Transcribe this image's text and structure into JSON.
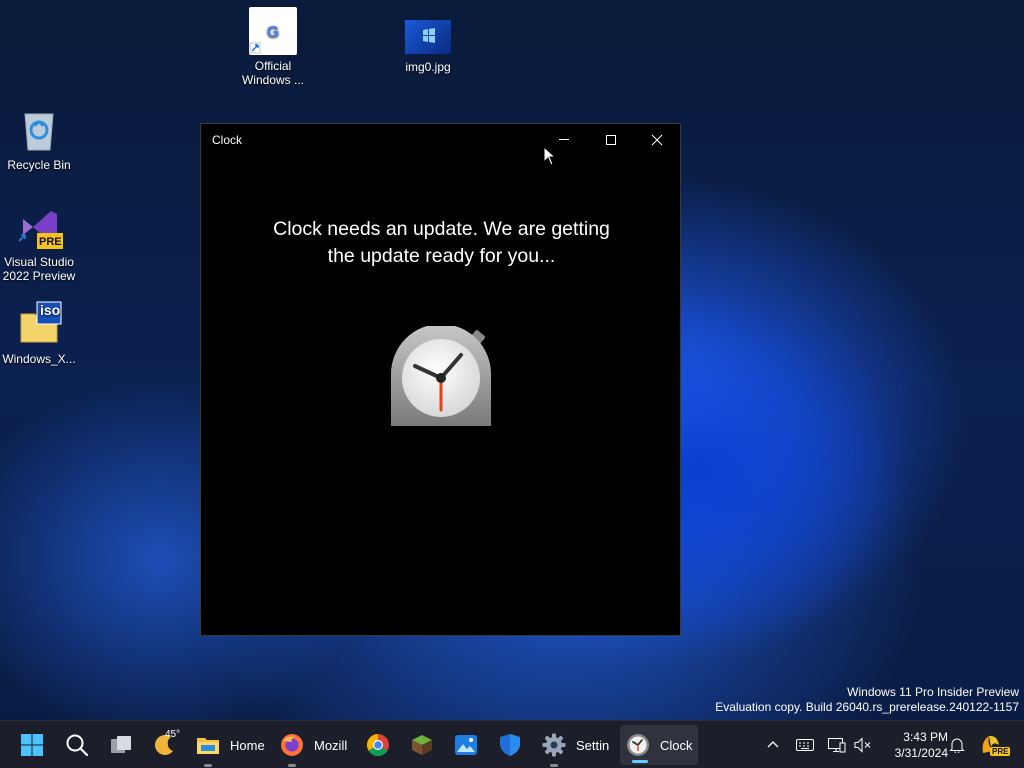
{
  "desktop": {
    "icons": [
      {
        "label": "Official Windows ...",
        "label_l1": "Official",
        "label_l2": "Windows ..."
      },
      {
        "label": "img0.jpg"
      },
      {
        "label": "Recycle Bin"
      },
      {
        "label": "Visual Studio 2022 Preview",
        "label_l1": "Visual Studio",
        "label_l2": "2022 Preview",
        "badge": "PRE"
      },
      {
        "label": "Windows_X...",
        "badge": "iso"
      }
    ]
  },
  "window": {
    "title": "Clock",
    "message_line1": "Clock needs an update. We are getting",
    "message_line2": "the update ready for you...",
    "controls": {
      "minimize": "minimize-icon",
      "maximize": "maximize-icon",
      "close": "close-icon"
    }
  },
  "watermark": {
    "line1": "Windows 11 Pro Insider Preview",
    "line2": "Evaluation copy. Build 26040.rs_prerelease.240122-1157"
  },
  "taskbar": {
    "weather_temp": "45°",
    "items": [
      {
        "name": "start",
        "icon": "windows-logo-icon"
      },
      {
        "name": "search",
        "icon": "search-icon"
      },
      {
        "name": "task-view",
        "icon": "task-view-icon"
      },
      {
        "name": "weather",
        "icon": "weather-icon"
      },
      {
        "name": "file-explorer",
        "label": "Home",
        "icon": "folder-icon"
      },
      {
        "name": "firefox",
        "label": "Mozill",
        "icon": "firefox-icon"
      },
      {
        "name": "chrome",
        "icon": "chrome-icon"
      },
      {
        "name": "minecraft",
        "icon": "grass-block-icon"
      },
      {
        "name": "photos",
        "icon": "photos-icon"
      },
      {
        "name": "defender",
        "icon": "shield-icon"
      },
      {
        "name": "settings",
        "label": "Settin",
        "icon": "gear-icon"
      },
      {
        "name": "clock",
        "label": "Clock",
        "icon": "clock-icon"
      }
    ],
    "tray": {
      "time": "3:43 PM",
      "date": "3/31/2024",
      "badge": "PRE"
    }
  },
  "colors": {
    "accent": "#60cdff",
    "taskbar_bg": "#1c1f2a",
    "window_bg": "#000000"
  }
}
